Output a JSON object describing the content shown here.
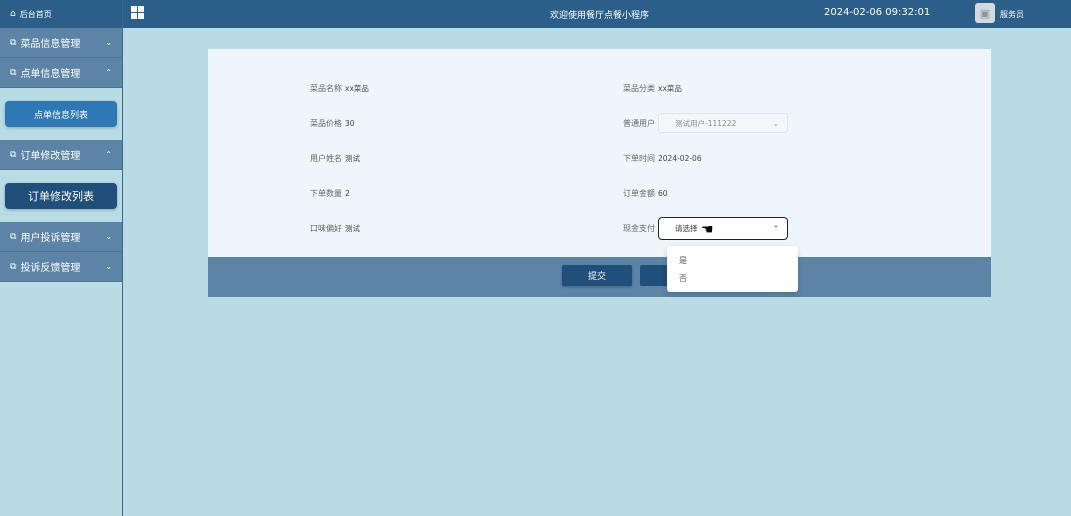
{
  "sidebar": {
    "home": "后台首页",
    "groups": [
      {
        "label": "菜品信息管理",
        "expanded": false
      },
      {
        "label": "点单信息管理",
        "expanded": true,
        "child": "点单信息列表"
      },
      {
        "label": "订单修改管理",
        "expanded": true,
        "child": "订单修改列表"
      },
      {
        "label": "用户投诉管理",
        "expanded": false
      },
      {
        "label": "投诉反馈管理",
        "expanded": false
      }
    ]
  },
  "topbar": {
    "title": "欢迎使用餐厅点餐小程序",
    "datetime": "2024-02-06 09:32:01",
    "user": "服务员"
  },
  "form": {
    "dish_name": {
      "label": "菜品名称",
      "value": "xx菜品"
    },
    "dish_category": {
      "label": "菜品分类",
      "value": "xx菜品"
    },
    "dish_price": {
      "label": "菜品价格",
      "value": "30"
    },
    "normal_user": {
      "label": "普通用户",
      "value": "测试用户-111222"
    },
    "user_name": {
      "label": "用户姓名",
      "value": "测试"
    },
    "order_time": {
      "label": "下单时间",
      "value": "2024-02-06"
    },
    "quantity": {
      "label": "下单数量",
      "value": "2"
    },
    "order_amount": {
      "label": "订单金额",
      "value": "60"
    },
    "taste": {
      "label": "口味偏好",
      "value": "测试"
    },
    "cash_pay": {
      "label": "现金支付",
      "placeholder": "请选择",
      "options": [
        "是",
        "否"
      ]
    }
  },
  "buttons": {
    "submit": "提交"
  }
}
